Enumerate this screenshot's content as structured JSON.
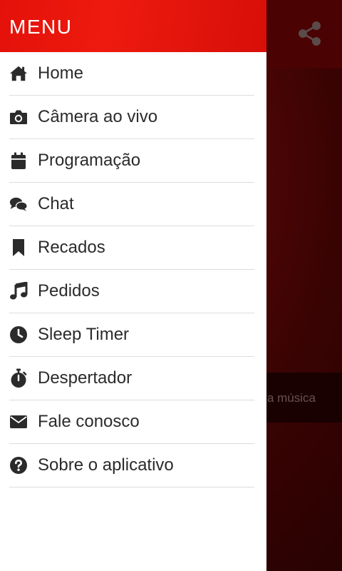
{
  "background": {
    "now_playing_text": "a música",
    "share_icon": "share-icon"
  },
  "drawer": {
    "title": "MENU",
    "accent_color": "#e8140c",
    "items": [
      {
        "label": "Home",
        "icon": "home-icon"
      },
      {
        "label": "Câmera ao vivo",
        "icon": "camera-icon"
      },
      {
        "label": "Programação",
        "icon": "calendar-icon"
      },
      {
        "label": "Chat",
        "icon": "chat-icon"
      },
      {
        "label": "Recados",
        "icon": "bookmark-icon"
      },
      {
        "label": "Pedidos",
        "icon": "music-note-icon"
      },
      {
        "label": "Sleep Timer",
        "icon": "clock-icon"
      },
      {
        "label": "Despertador",
        "icon": "stopwatch-icon"
      },
      {
        "label": "Fale conosco",
        "icon": "envelope-icon"
      },
      {
        "label": "Sobre o aplicativo",
        "icon": "question-circle-icon"
      }
    ]
  }
}
